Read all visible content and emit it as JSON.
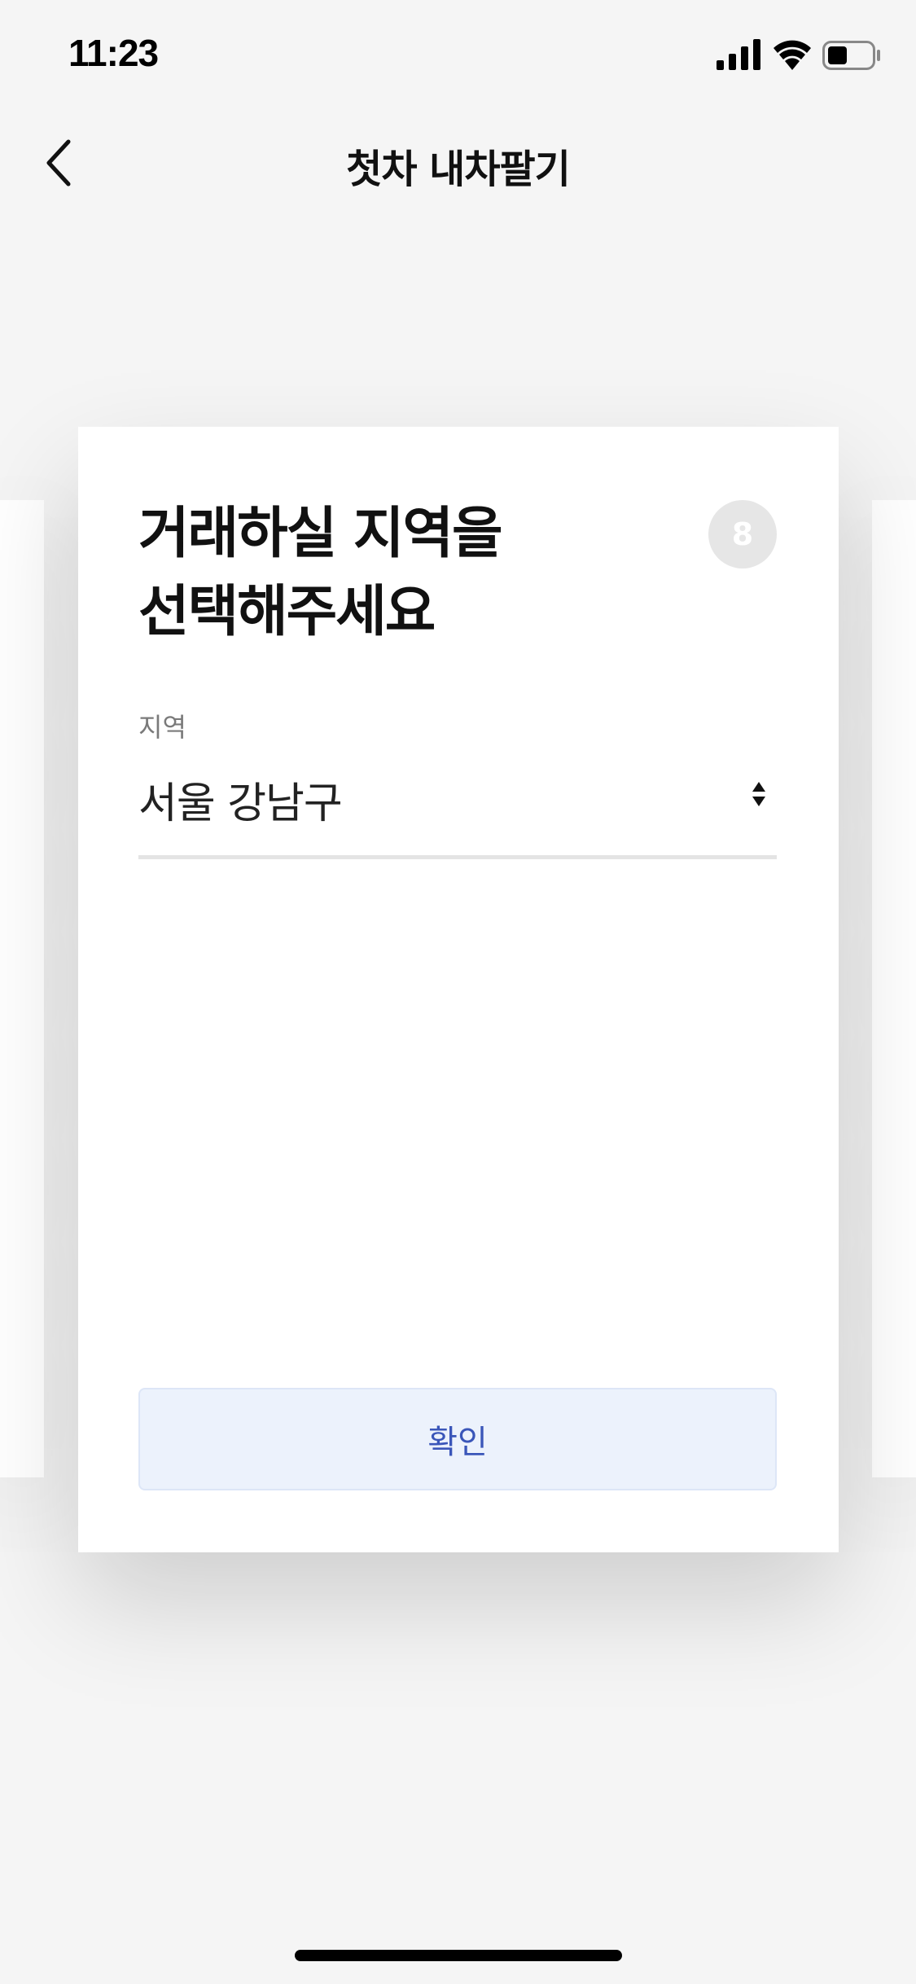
{
  "status_bar": {
    "time": "11:23",
    "icons": [
      "signal-icon",
      "wifi-icon",
      "battery-icon"
    ],
    "battery_level": 0.45
  },
  "nav": {
    "back_icon": "chevron-left-icon",
    "title": "첫차 내차팔기"
  },
  "card": {
    "title_line1": "거래하실 지역을",
    "title_line2": "선택해주세요",
    "step_number": "8",
    "field_label": "지역",
    "region_value": "서울 강남구",
    "select_icon": "select-arrows-icon",
    "confirm_label": "확인"
  },
  "colors": {
    "background": "#f5f5f5",
    "card": "#ffffff",
    "badge": "#e6e6e6",
    "button_bg": "#ecf2fc",
    "button_text": "#3a56b9"
  }
}
